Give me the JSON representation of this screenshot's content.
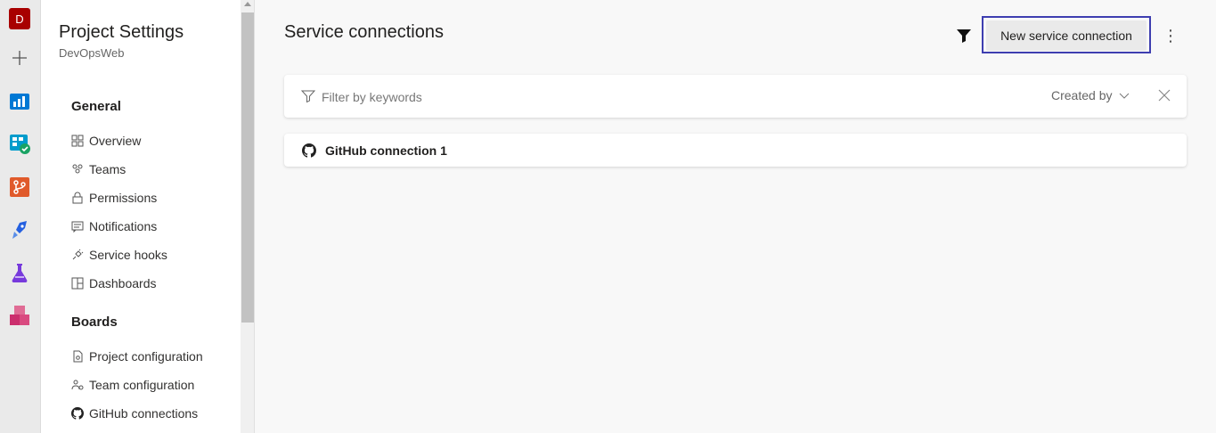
{
  "rail": {
    "org_initial": "D",
    "items": [
      "organization-avatar",
      "add-icon",
      "overview-icon",
      "boards-icon",
      "repos-icon",
      "pipelines-icon",
      "test-plans-icon",
      "artifacts-icon"
    ],
    "colors": {
      "org": "#a80000",
      "overview": "#0078d4",
      "boards": "#009ccc",
      "repos": "#e05a2b",
      "pipelines": "#2560e0",
      "test_plans": "#773adc",
      "artifacts": "#cb2e6d"
    }
  },
  "nav": {
    "title": "Project Settings",
    "subtitle": "DevOpsWeb",
    "sections": [
      {
        "label": "General",
        "items": [
          {
            "label": "Overview",
            "icon": "overview-icon"
          },
          {
            "label": "Teams",
            "icon": "teams-icon"
          },
          {
            "label": "Permissions",
            "icon": "lock-icon"
          },
          {
            "label": "Notifications",
            "icon": "notification-icon"
          },
          {
            "label": "Service hooks",
            "icon": "plug-icon"
          },
          {
            "label": "Dashboards",
            "icon": "dashboard-icon"
          }
        ]
      },
      {
        "label": "Boards",
        "items": [
          {
            "label": "Project configuration",
            "icon": "document-settings-icon"
          },
          {
            "label": "Team configuration",
            "icon": "team-settings-icon"
          },
          {
            "label": "GitHub connections",
            "icon": "github-icon"
          }
        ]
      }
    ]
  },
  "main": {
    "title": "Service connections",
    "new_button": "New service connection",
    "more_label": "⋮",
    "filter": {
      "placeholder": "Filter by keywords",
      "created_by": "Created by"
    },
    "connections": [
      {
        "label": "GitHub connection 1",
        "icon": "github-icon"
      }
    ]
  },
  "colors": {
    "accent_outline": "#3e3eb0",
    "background": "#f8f8f8"
  }
}
